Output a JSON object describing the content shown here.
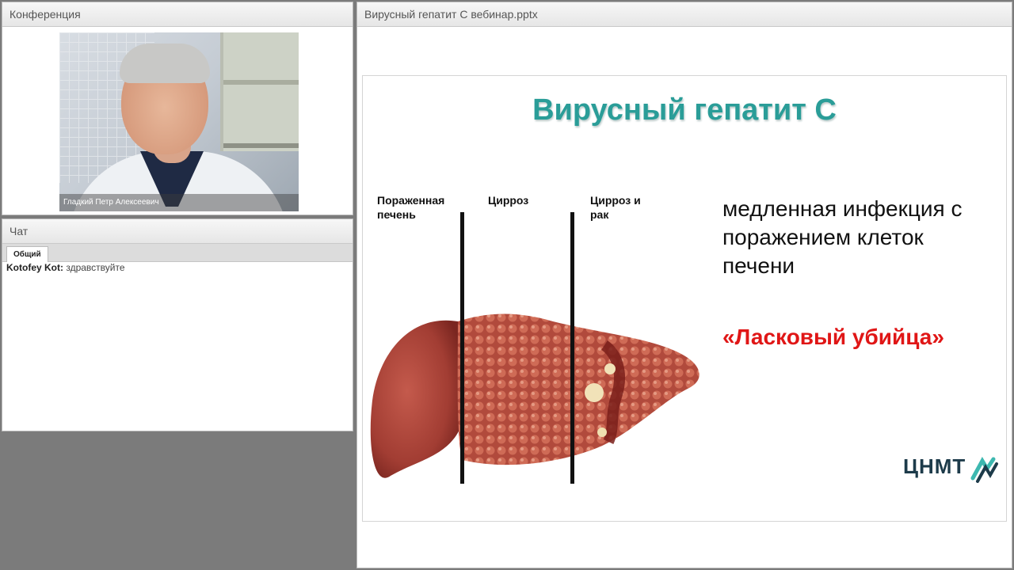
{
  "conference": {
    "title": "Конференция",
    "speaker_name": "Гладкий Петр Алексеевич"
  },
  "chat": {
    "title": "Чат",
    "tab_label": "Общий",
    "messages": [
      {
        "user": "Kotofey Kot:",
        "text": "здравствуйте"
      }
    ]
  },
  "presentation": {
    "file_title": "Вирусный гепатит С вебинар.pptx",
    "slide": {
      "title": "Вирусный гепатит С",
      "stage_labels": [
        "Пораженная печень",
        "Цирроз",
        "Цирроз и рак"
      ],
      "body_lines": [
        "медленная инфекция с",
        "поражением клеток",
        "печени"
      ],
      "emphasis": "«Ласковый убийца»",
      "logo": "ЦНМТ"
    }
  },
  "colors": {
    "title_teal": "#2a9d98",
    "emphasis_red": "#e01616",
    "liver_red": "#a8453a"
  },
  "icons": {
    "logo_mark": "cnmt-logo-icon"
  }
}
